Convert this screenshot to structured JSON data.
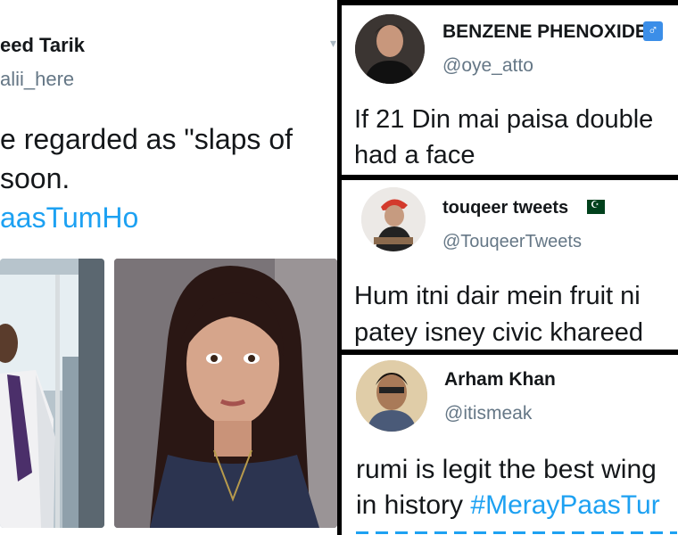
{
  "left_tweet": {
    "name": "eed Tarik",
    "handle": "alii_here",
    "line1": "e regarded as \"slaps of",
    "line2": "soon.",
    "hashtag": "aasTumHo"
  },
  "right_tweets": [
    {
      "name": "BENZENE PHENOXIDE",
      "badge": "♂",
      "handle": "@oye_atto",
      "line1": "If 21 Din mai paisa double",
      "line2": "had a face"
    },
    {
      "name": "touqeer tweets",
      "badge": "flag-pakistan",
      "handle": "@TouqeerTweets",
      "line1": "Hum itni dair mein fruit ni",
      "line2": "patey isney civic khareed"
    },
    {
      "name": "Arham Khan",
      "handle": "@itismeak",
      "line1": "rumi is legit the best wing",
      "line2_prefix": "in history ",
      "line2_tag": "#MerayPaasTur"
    }
  ],
  "colors": {
    "link": "#1da1f2",
    "text": "#14171a",
    "muted": "#657786",
    "badge_bg": "#3b8ee8",
    "flag_green": "#01411c"
  }
}
